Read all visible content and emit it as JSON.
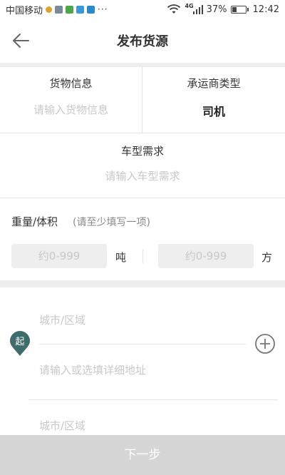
{
  "status_bar": {
    "carrier": "中国移动",
    "overflow": "···",
    "network": "4G",
    "battery_percent": "37%",
    "battery_level": 0.37,
    "time": "12:42"
  },
  "nav": {
    "title": "发布货源"
  },
  "cargo": {
    "label": "货物信息",
    "placeholder": "请输入货物信息"
  },
  "carrier_type": {
    "label": "承运商类型",
    "value": "司机"
  },
  "vehicle": {
    "label": "车型需求",
    "placeholder": "请输入车型需求"
  },
  "weight_volume": {
    "label": "重量/体积",
    "hint": "(请至少填写一项)",
    "weight_placeholder": "约0-999",
    "weight_unit": "吨",
    "volume_placeholder": "约0-999",
    "volume_unit": "方"
  },
  "start": {
    "badge": "起",
    "city_placeholder": "城市/区域",
    "address_placeholder": "请输入或选填详细地址"
  },
  "end": {
    "city_placeholder": "城市/区域"
  },
  "footer": {
    "next_label": "下一步"
  },
  "colors": {
    "accent_pin": "#3e6b6b",
    "placeholder": "#c8c8c8",
    "divider": "#eeeeee",
    "button_disabled": "#d6d6d6"
  }
}
